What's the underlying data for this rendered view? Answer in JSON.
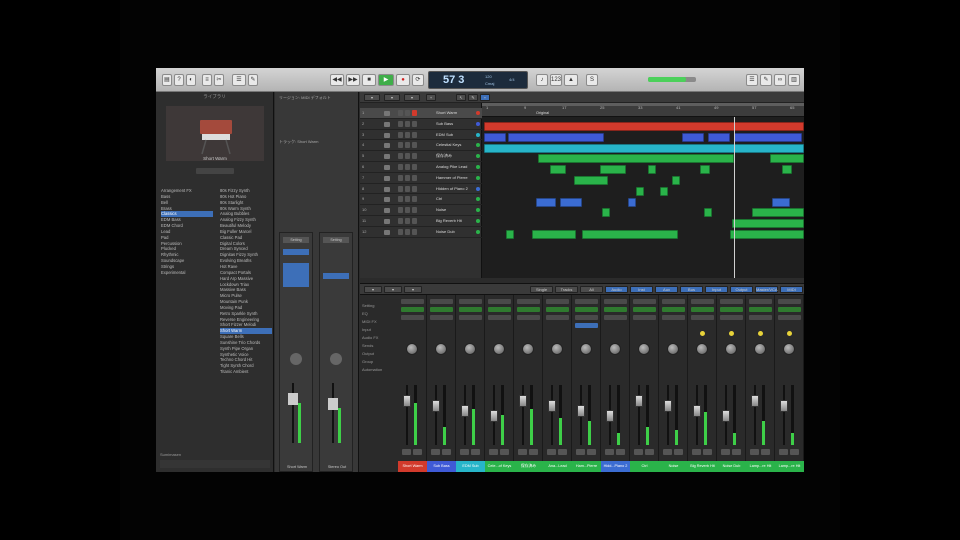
{
  "transport": {
    "position": "57 3",
    "bpm": "120",
    "key": "Cmaj",
    "sig": "4/4"
  },
  "library": {
    "header": "ライブラリ",
    "patch_name": "Short Warm",
    "col1": [
      "Arrangement FX",
      "Bass",
      "Bell",
      "Brass",
      "Classics",
      "EDM Bass",
      "EDM Chord",
      "Lead",
      "Pad",
      "Percussion",
      "Plucked",
      "Rhythmic",
      "Soundscape",
      "Strings",
      "Experimental"
    ],
    "col1_selected": 4,
    "col2": [
      "80s Fizzy Synth",
      "80s Hot Piano",
      "80s Starlight",
      "80s Warm Synth",
      "Analog Bubbles",
      "Analog Fizzy Synth",
      "Beautiful Melody",
      "Big Fuller Marcel",
      "Classic Pad",
      "Digital Colors",
      "Dream Synced",
      "Dignitas Fizzy Synth",
      "Evolving Breaths",
      "Hot Rave",
      "Compact Portals",
      "Hard Arp Massive",
      "Lockdown Triax",
      "Massive Bass",
      "Micro Pulse",
      "Mountain Punk",
      "Moving Pad",
      "Retro Sparkle Synth",
      "Reverse Engineering",
      "Short Fizzer Melodi",
      "Short Warm",
      "Square Bells",
      "Sunshine Trio Chords",
      "Synth Pipe Organ",
      "Synthetic Voice",
      "Techno Chord Hit",
      "Tight Synth Chord",
      "Titanic Ambient"
    ],
    "col2_selected": 24,
    "footer": "Sumimasen"
  },
  "inspector": {
    "region": "リージョン: MIDI デフォルト",
    "track": "トラック: Short Warm",
    "stripA": "Short Warm",
    "stripB": "Stereo Out",
    "settingA": "Setting",
    "settingB": "Setting"
  },
  "tracks": [
    {
      "num": "1",
      "name": "Short Warm",
      "color": "#d23a2c"
    },
    {
      "num": "2",
      "name": "Sub Bass",
      "color": "#3f5ad6"
    },
    {
      "num": "3",
      "name": "EDM Sub",
      "color": "#27b5c9"
    },
    {
      "num": "4",
      "name": "Celestial Keys",
      "color": "#2ab34a"
    },
    {
      "num": "5",
      "name": "保存済み",
      "color": "#2ab34a"
    },
    {
      "num": "6",
      "name": "Analog Pike Lead",
      "color": "#2ab34a"
    },
    {
      "num": "7",
      "name": "Hammer of Pierre",
      "color": "#2ab34a"
    },
    {
      "num": "8",
      "name": "Hidden of Piano 2",
      "color": "#3b6cd2"
    },
    {
      "num": "9",
      "name": "Ctrl",
      "color": "#2ab34a"
    },
    {
      "num": "10",
      "name": "Noise",
      "color": "#2ab34a"
    },
    {
      "num": "11",
      "name": "Big Reverb Hit",
      "color": "#2ab34a"
    },
    {
      "num": "12",
      "name": "Noise Dub",
      "color": "#2ab34a"
    }
  ],
  "ruler": [
    "1",
    "9",
    "17",
    "25",
    "33",
    "41",
    "49",
    "57",
    "65"
  ],
  "marker": "Original",
  "channels": [
    {
      "name": "Short Warm",
      "color": "#d23a2c"
    },
    {
      "name": "Sub Bass",
      "color": "#3f5ad6"
    },
    {
      "name": "EDM Sub",
      "color": "#27b5c9"
    },
    {
      "name": "Cele...of Keys",
      "color": "#2ab34a"
    },
    {
      "name": "保存済み",
      "color": "#2ab34a"
    },
    {
      "name": "Ana...Lead",
      "color": "#2ab34a"
    },
    {
      "name": "Ham...Pierre",
      "color": "#2ab34a"
    },
    {
      "name": "Hidd...Piano 2",
      "color": "#3b6cd2"
    },
    {
      "name": "Ctrl",
      "color": "#2ab34a"
    },
    {
      "name": "Noise",
      "color": "#2ab34a"
    },
    {
      "name": "Big Reverb Hit",
      "color": "#2ab34a"
    },
    {
      "name": "Noise Dub",
      "color": "#2ab34a"
    },
    {
      "name": "Lamp...re Hit",
      "color": "#2ab34a"
    },
    {
      "name": "Lamp...re Hit",
      "color": "#2ab34a"
    }
  ],
  "mixer_tabs": [
    "Single",
    "Tracks",
    "All",
    "Audio",
    "Inst",
    "Aux",
    "Bus",
    "Input",
    "Output",
    "Master/VCA",
    "MIDI"
  ],
  "mixer_labels": [
    "Setting",
    "EQ",
    "MIDI FX",
    "Input",
    "Audio FX",
    "Sends",
    "Output",
    "Group",
    "Automation"
  ]
}
